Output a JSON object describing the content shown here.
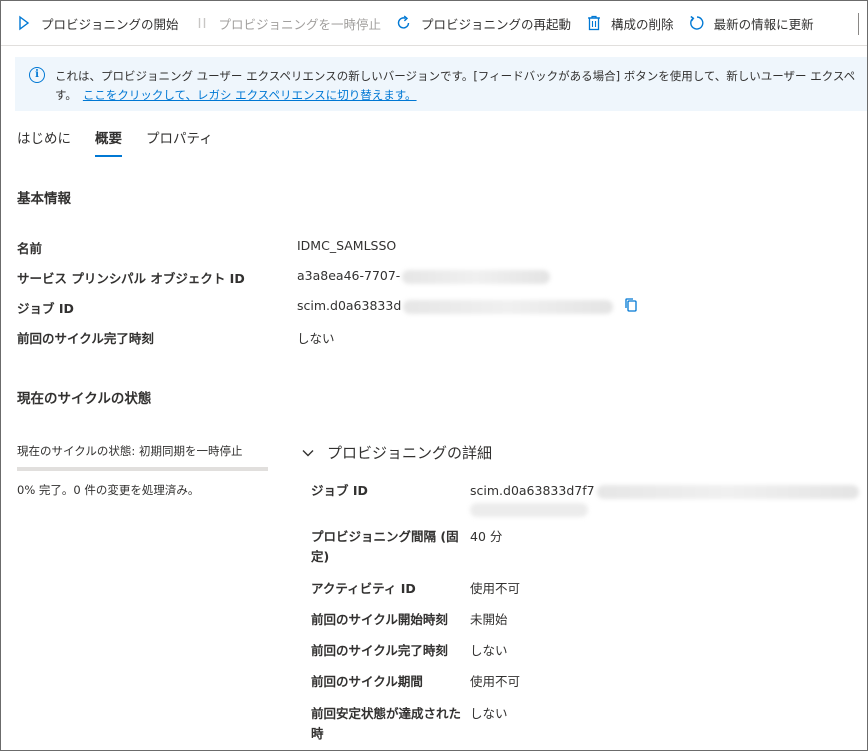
{
  "toolbar": {
    "start": "プロビジョニングの開始",
    "pause": "プロビジョニングを一時停止",
    "restart": "プロビジョニングの再起動",
    "delete": "構成の削除",
    "refresh": "最新の情報に更新"
  },
  "banner": {
    "line1": "これは、プロビジョニング ユーザー エクスペリエンスの新しいバージョンです。[フィードバックがある場合] ボタンを使用して、新しいユーザー エクスペ",
    "line2_prefix": "す。",
    "link": "ここをクリックして、レガシ エクスペリエンスに切り替えます。"
  },
  "tabs": [
    "はじめに",
    "概要",
    "プロパティ"
  ],
  "basic_info": {
    "title": "基本情報",
    "name_label": "名前",
    "name_value": "IDMC_SAMLSSO",
    "spoid_label": "サービス プリンシパル オブジェクト ID",
    "spoid_value": "a3a8ea46-7707-",
    "jobid_label": "ジョブ ID",
    "jobid_value": "scim.d0a63833d",
    "lastcycle_label": "前回のサイクル完了時刻",
    "lastcycle_value": "しない"
  },
  "cycle": {
    "title": "現在のサイクルの状態",
    "status_text": "現在のサイクルの状態: 初期同期を一時停止",
    "progress": 0,
    "progress_label": "0% 完了。0 件の変更を処理済み。"
  },
  "details": {
    "header": "プロビジョニングの詳細",
    "job_id_label": "ジョブ ID",
    "job_id_value": "scim.d0a63833d7f7",
    "interval_label": "プロビジョニング間隔 (固定)",
    "interval_value": "40 分",
    "activity_label": "アクティビティ ID",
    "activity_value": "使用不可",
    "start_label": "前回のサイクル開始時刻",
    "start_value": "未開始",
    "end_label": "前回のサイクル完了時刻",
    "end_value": "しない",
    "duration_label": "前回のサイクル期間",
    "duration_value": "使用不可",
    "steady_label": "前回安定状態が達成された時",
    "steady_value": "しない"
  },
  "colors": {
    "accent": "#0078d4",
    "banner_bg": "#eff6fc",
    "text": "#323130"
  },
  "icons": [
    "play-icon",
    "pause-icon",
    "restart-icon",
    "trash-icon",
    "refresh-icon",
    "info-icon",
    "copy-icon",
    "chevron-down-icon"
  ]
}
